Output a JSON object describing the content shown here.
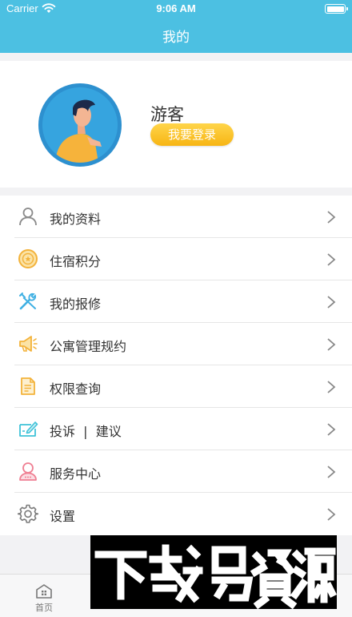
{
  "status_bar": {
    "carrier": "Carrier",
    "time": "9:06 AM"
  },
  "header": {
    "title": "我的"
  },
  "profile": {
    "username": "游客",
    "login_button": "我要登录",
    "avatar_icon": "user-avatar-icon"
  },
  "menu": {
    "items": [
      {
        "label": "我的资料",
        "icon": "user-icon",
        "color": "#8a8a8a"
      },
      {
        "label": "住宿积分",
        "icon": "coin-icon",
        "color": "#f3b23a"
      },
      {
        "label": "我的报修",
        "icon": "tools-icon",
        "color": "#3fb0e3"
      },
      {
        "label": "公寓管理规约",
        "icon": "megaphone-icon",
        "color": "#f3b23a"
      },
      {
        "label": "权限查询",
        "icon": "document-icon",
        "color": "#f3b23a"
      },
      {
        "label": "投诉  |  建议",
        "icon": "feedback-icon",
        "color": "#3fc2d8"
      },
      {
        "label": "服务中心",
        "icon": "service-person-icon",
        "color": "#ef7f92"
      },
      {
        "label": "设置",
        "icon": "gear-icon",
        "color": "#7a7a7a"
      }
    ]
  },
  "tabbar": {
    "tabs": [
      {
        "label": "首页",
        "icon": "home-icon"
      },
      {
        "label": "",
        "icon": "tab-2-icon"
      },
      {
        "label": "",
        "icon": "tab-3-icon"
      },
      {
        "label": "",
        "icon": "tab-4-icon",
        "active": true
      }
    ]
  },
  "colors": {
    "accent": "#4cc0e2",
    "login_button": "#f7b514"
  }
}
